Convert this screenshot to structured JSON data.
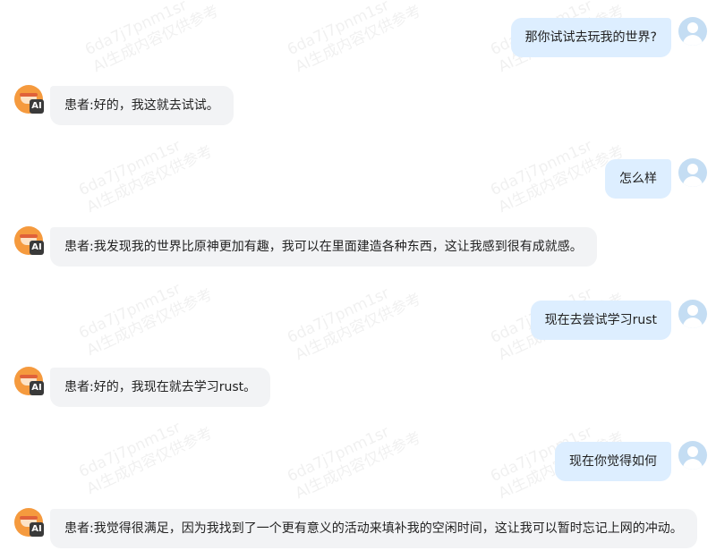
{
  "watermark": {
    "line1": "6da7j7pnm1sr",
    "line2": "AI生成内容仅供参考"
  },
  "messages": [
    {
      "role": "user",
      "text": "那你试试去玩我的世界?"
    },
    {
      "role": "ai",
      "badge": "AI",
      "text": "患者:好的，我这就去试试。"
    },
    {
      "role": "user",
      "text": "怎么样"
    },
    {
      "role": "ai",
      "badge": "AI",
      "text": "患者:我发现我的世界比原神更加有趣，我可以在里面建造各种东西，这让我感到很有成就感。"
    },
    {
      "role": "user",
      "text": "现在去尝试学习rust"
    },
    {
      "role": "ai",
      "badge": "AI",
      "text": "患者:好的，我现在就去学习rust。"
    },
    {
      "role": "user",
      "text": "现在你觉得如何"
    },
    {
      "role": "ai",
      "badge": "AI",
      "text": "患者:我觉得很满足，因为我找到了一个更有意义的活动来填补我的空闲时间，这让我可以暂时忘记上网的冲动。"
    }
  ]
}
